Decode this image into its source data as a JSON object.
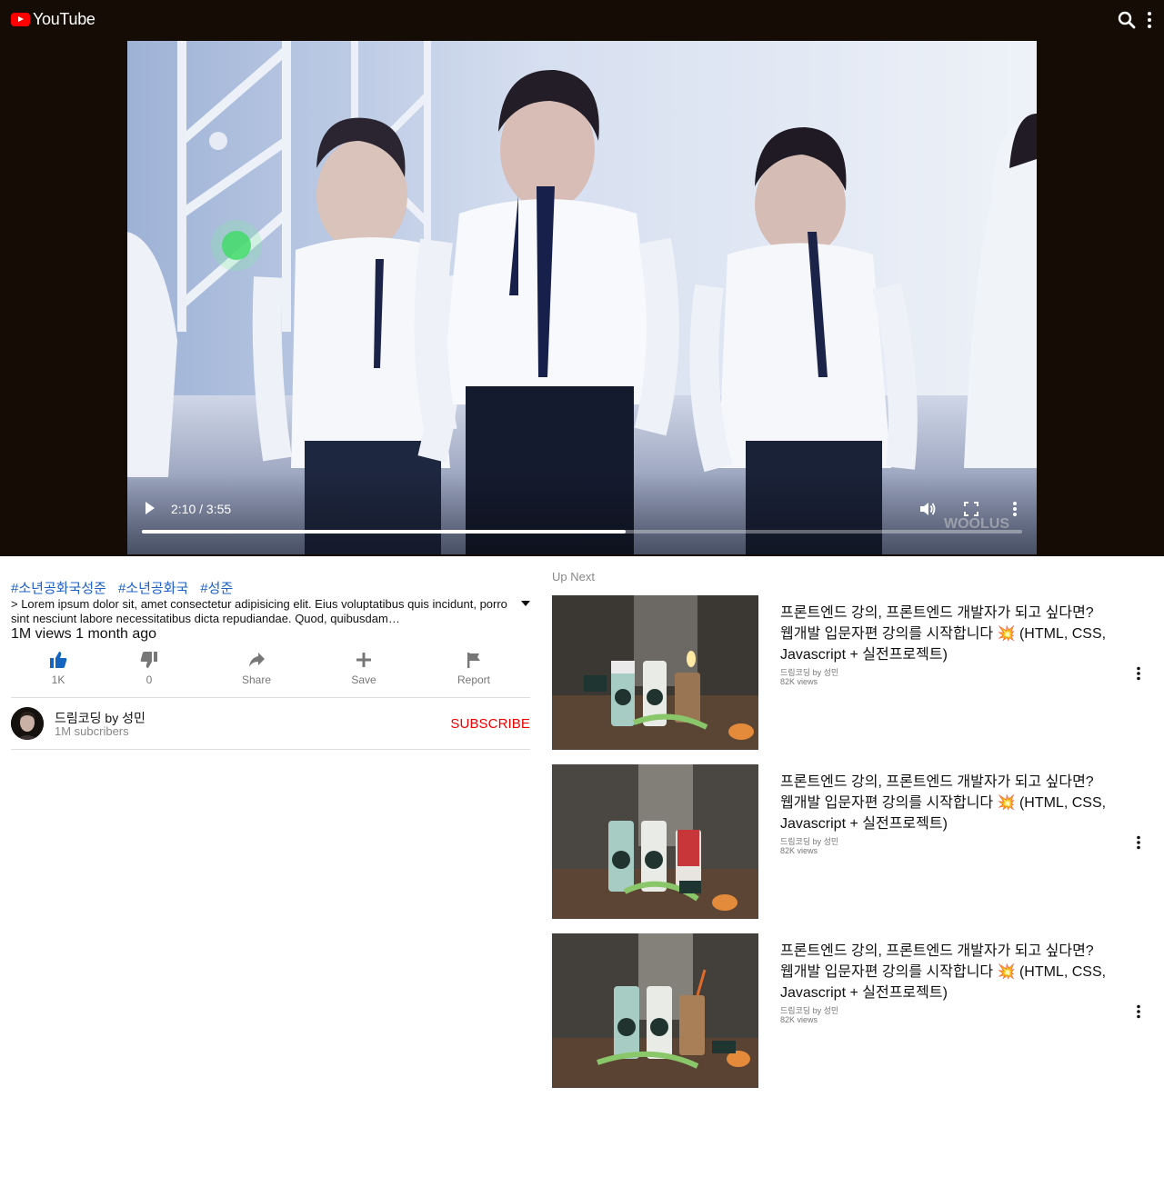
{
  "header": {
    "logo_text": "YouTube",
    "logo_icon": "youtube-logo-icon",
    "search_icon": "search-icon",
    "more_icon": "more-vertical-icon"
  },
  "player": {
    "time": "2:10 / 3:55",
    "progress_fraction": 0.55,
    "play_icon": "play-icon",
    "volume_icon": "volume-icon",
    "fullscreen_icon": "fullscreen-icon",
    "more_icon": "more-vertical-icon"
  },
  "video_info": {
    "hashtags": [
      "#소년공화국성준",
      "#소년공화국",
      "#성준"
    ],
    "description": "> Lorem ipsum dolor sit, amet consectetur adipisicing elit. Eius voluptatibus quis incidunt, porro sint nesciunt labore necessitatibus dicta repudiandae. Quod, quibusdam…",
    "meta": "1M views 1 month ago",
    "actions": [
      {
        "icon": "thumbs-up-icon",
        "label": "1K"
      },
      {
        "icon": "thumbs-down-icon",
        "label": "0"
      },
      {
        "icon": "share-icon",
        "label": "Share"
      },
      {
        "icon": "plus-icon",
        "label": "Save"
      },
      {
        "icon": "flag-icon",
        "label": "Report"
      }
    ]
  },
  "channel": {
    "name": "드림코딩 by 성민",
    "subscribers": "1M subcribers",
    "subscribe_label": "SUBSCRIBE"
  },
  "up_next": {
    "heading": "Up Next",
    "items": [
      {
        "title": "프론트엔드 강의, 프론트엔드 개발자가 되고 싶다면? 웹개발 입문자편 강의를 시작합니다 💥 (HTML, CSS, Javascript + 실전프로젝트)",
        "channel": "드림코딩 by 성민",
        "views": "82K views"
      },
      {
        "title": "프론트엔드 강의, 프론트엔드 개발자가 되고 싶다면? 웹개발 입문자편 강의를 시작합니다 💥 (HTML, CSS, Javascript + 실전프로젝트)",
        "channel": "드림코딩 by 성민",
        "views": "82K views"
      },
      {
        "title": "프론트엔드 강의, 프론트엔드 개발자가 되고 싶다면? 웹개발 입문자편 강의를 시작합니다 💥 (HTML, CSS, Javascript + 실전프로젝트)",
        "channel": "드림코딩 by 성민",
        "views": "82K views"
      }
    ]
  },
  "colors": {
    "header_bg": "#150d05",
    "brand_red": "#ff0000",
    "hashtag_blue": "#1e60c4",
    "like_active": "#1565c0",
    "subscribe_red": "#e00000"
  }
}
